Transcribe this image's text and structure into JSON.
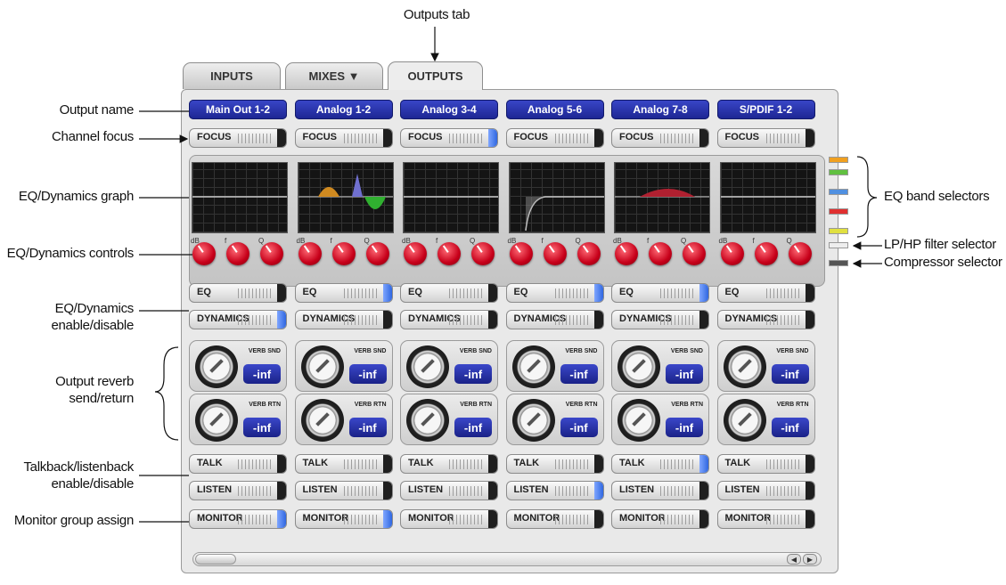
{
  "tabs": [
    {
      "label": "INPUTS"
    },
    {
      "label": "MIXES ▼"
    },
    {
      "label": "OUTPUTS"
    }
  ],
  "channels": [
    {
      "name": "Main Out 1-2",
      "focus_on": false,
      "eq_on": false,
      "dyn_on": true,
      "talk_on": false,
      "listen_on": false,
      "monitor_on": true,
      "verb_snd": "-inf",
      "verb_rtn": "-inf",
      "curve": "flat"
    },
    {
      "name": "Analog 1-2",
      "focus_on": false,
      "eq_on": true,
      "dyn_on": false,
      "talk_on": false,
      "listen_on": false,
      "monitor_on": true,
      "verb_snd": "-inf",
      "verb_rtn": "-inf",
      "curve": "bands"
    },
    {
      "name": "Analog 3-4",
      "focus_on": true,
      "eq_on": false,
      "dyn_on": false,
      "talk_on": false,
      "listen_on": false,
      "monitor_on": false,
      "verb_snd": "-inf",
      "verb_rtn": "-inf",
      "curve": "flat"
    },
    {
      "name": "Analog 5-6",
      "focus_on": false,
      "eq_on": true,
      "dyn_on": false,
      "talk_on": false,
      "listen_on": true,
      "monitor_on": false,
      "verb_snd": "-inf",
      "verb_rtn": "-inf",
      "curve": "highpass"
    },
    {
      "name": "Analog 7-8",
      "focus_on": false,
      "eq_on": true,
      "dyn_on": false,
      "talk_on": true,
      "listen_on": false,
      "monitor_on": false,
      "verb_snd": "-inf",
      "verb_rtn": "-inf",
      "curve": "bump"
    },
    {
      "name": "S/PDIF 1-2",
      "focus_on": false,
      "eq_on": false,
      "dyn_on": false,
      "talk_on": false,
      "listen_on": false,
      "monitor_on": false,
      "verb_snd": "-inf",
      "verb_rtn": "-inf",
      "curve": "flat"
    }
  ],
  "button_labels": {
    "focus": "FOCUS",
    "eq": "EQ",
    "dynamics": "DYNAMICS",
    "talk": "TALK",
    "listen": "LISTEN",
    "monitor": "MONITOR"
  },
  "knob_labels": {
    "db": "dB",
    "freq": "f",
    "q": "Q"
  },
  "verb_labels": {
    "snd": "VERB SND",
    "rtn": "VERB RTN"
  },
  "band_selector_colors": [
    "#f0a020",
    "#60c040",
    "#5090e0",
    "#e03030",
    "#e0e040"
  ],
  "annotations": {
    "outputs_tab": "Outputs tab",
    "output_name": "Output name",
    "channel_focus": "Channel focus",
    "eq_graph": "EQ/Dynamics graph",
    "eq_controls": "EQ/Dynamics controls",
    "eq_enable_1": "EQ/Dynamics",
    "eq_enable_2": "enable/disable",
    "reverb_1": "Output reverb",
    "reverb_2": "send/return",
    "talk_1": "Talkback/listenback",
    "talk_2": "enable/disable",
    "monitor": "Monitor group assign",
    "band_selectors": "EQ band selectors",
    "filter_selector": "LP/HP filter selector",
    "compressor_selector": "Compressor selector"
  }
}
